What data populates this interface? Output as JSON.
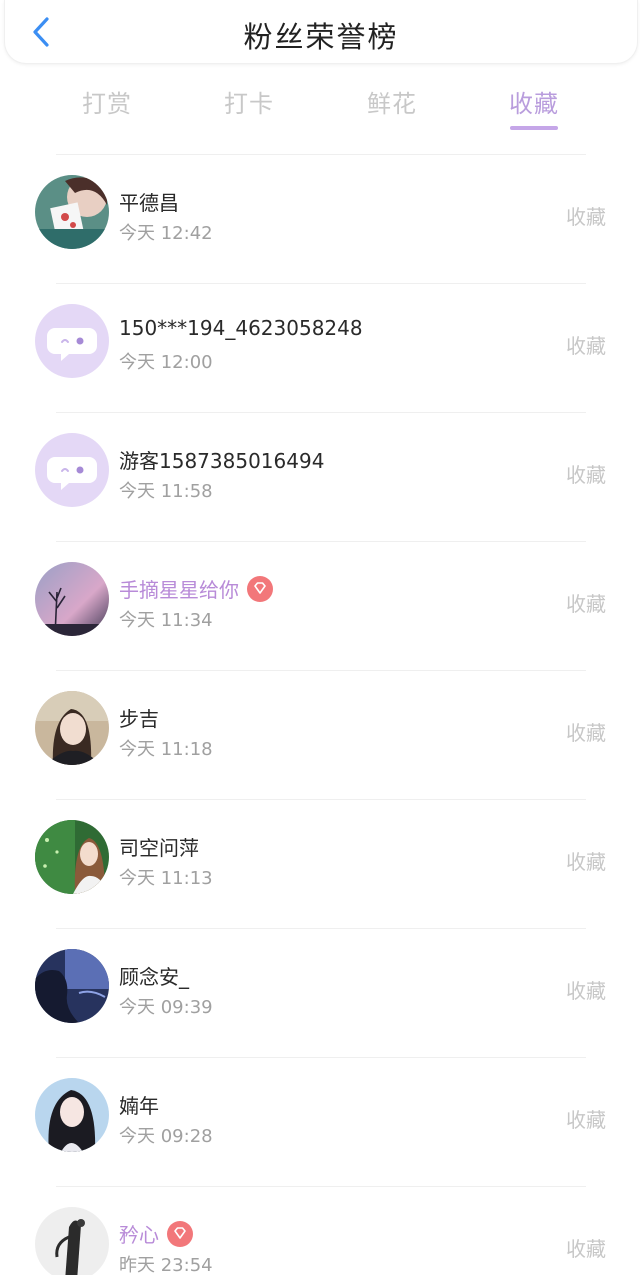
{
  "header": {
    "title": "粉丝荣誉榜",
    "back_icon": "chevron-left-icon"
  },
  "tabs": [
    {
      "label": "打赏",
      "active": false
    },
    {
      "label": "打卡",
      "active": false
    },
    {
      "label": "鲜花",
      "active": false
    },
    {
      "label": "收藏",
      "active": true
    }
  ],
  "colors": {
    "accent": "#b99ddd",
    "vip_name": "#b88bd8",
    "vip_badge": "#f2777a",
    "inactive_tab": "#c8c8c8",
    "back_icon": "#3b8ef3"
  },
  "fans": [
    {
      "name": "平德昌",
      "time": "今天 12:42",
      "action": "收藏",
      "vip": false,
      "avatar": "photo-avatar"
    },
    {
      "name": "150***194_4623058248",
      "time": "今天 12:00",
      "action": "收藏",
      "vip": false,
      "avatar": "default-chat-avatar"
    },
    {
      "name": "游客1587385016494",
      "time": "今天 11:58",
      "action": "收藏",
      "vip": false,
      "avatar": "default-chat-avatar"
    },
    {
      "name": "手摘星星给你",
      "time": "今天 11:34",
      "action": "收藏",
      "vip": true,
      "avatar": "photo-avatar"
    },
    {
      "name": "步吉",
      "time": "今天 11:18",
      "action": "收藏",
      "vip": false,
      "avatar": "photo-avatar"
    },
    {
      "name": "司空问萍",
      "time": "今天 11:13",
      "action": "收藏",
      "vip": false,
      "avatar": "photo-avatar"
    },
    {
      "name": "顾念安_",
      "time": "今天 09:39",
      "action": "收藏",
      "vip": false,
      "avatar": "photo-avatar"
    },
    {
      "name": "婻年",
      "time": "今天 09:28",
      "action": "收藏",
      "vip": false,
      "avatar": "photo-avatar"
    },
    {
      "name": "矜心",
      "time": "昨天 23:54",
      "action": "收藏",
      "vip": true,
      "avatar": "photo-avatar"
    }
  ]
}
